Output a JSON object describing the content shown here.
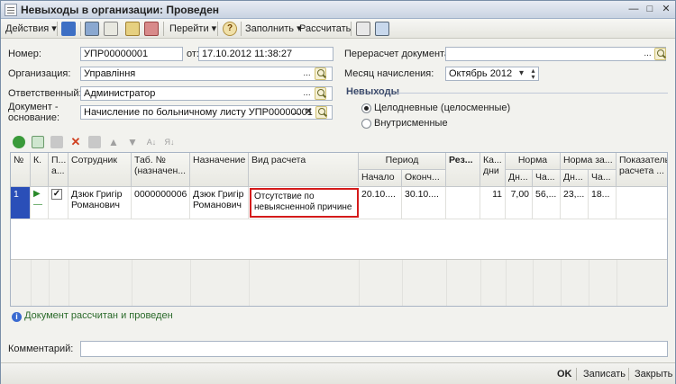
{
  "window": {
    "title": "Невыходы в организации: Проведен"
  },
  "toolbar": {
    "actions": "Действия",
    "goto": "Перейти",
    "help": "?",
    "fill": "Заполнить",
    "calculate": "Рассчитать"
  },
  "form": {
    "number_label": "Номер:",
    "number": "УПР00000001",
    "from_label": "от:",
    "date": "17.10.2012 11:38:27",
    "org_label": "Организация:",
    "org": "Управління",
    "resp_label": "Ответственный:",
    "resp": "Администратор",
    "basis_label_1": "Документ -",
    "basis_label_2": "основание:",
    "basis": "Начисление по больничному листу УПР00000001",
    "recalc_label": "Перерасчет документа:",
    "recalc": "",
    "month_label": "Месяц начисления:",
    "month": "Октябрь 2012"
  },
  "absences": {
    "title": "Невыходы",
    "opt_fullday": "Целодневные (целосменные)",
    "opt_intrashift": "Внутрисменные",
    "selected": "fullday"
  },
  "grid": {
    "headers": {
      "n": "№",
      "k": "К.",
      "p1": "П...",
      "p2": "а...",
      "employee": "Сотрудник",
      "tab1": "Таб. №",
      "tab2": "(назначен...",
      "assign": "Назначение",
      "calc": "Вид расчета",
      "period": "Период",
      "start": "Начало",
      "end": "Оконч...",
      "res": "Рез...",
      "cal1": "Ка...",
      "cal2": "дни",
      "norm": "Норма",
      "norm_d": "Дн...",
      "norm_h": "Ча...",
      "norm2": "Норма за...",
      "norm2_d": "Дн...",
      "norm2_h": "Ча...",
      "ind1": "Показатель",
      "ind2": "расчета ..."
    },
    "rows": [
      {
        "n": "1",
        "employee": "Дзюк Григір Романович",
        "tab": "0000000006",
        "assign": "Дзюк Григір Романович",
        "calc": "Отсутствие по невыясненной причине",
        "start": "20.10....",
        "end": "30.10....",
        "res": "",
        "cal_days": "11",
        "norm_d": "7,00",
        "norm_h": "56,...",
        "norm2_d": "23,...",
        "norm2_h": "18...",
        "ind": ""
      }
    ]
  },
  "status": "Документ рассчитан и проведен",
  "comment_label": "Комментарий:",
  "comment": "",
  "buttons": {
    "ok": "OK",
    "save": "Записать",
    "close": "Закрыть"
  },
  "colors": {
    "selected_cell_border": "#d41b1b",
    "row_selected": "#2a4fb8"
  }
}
